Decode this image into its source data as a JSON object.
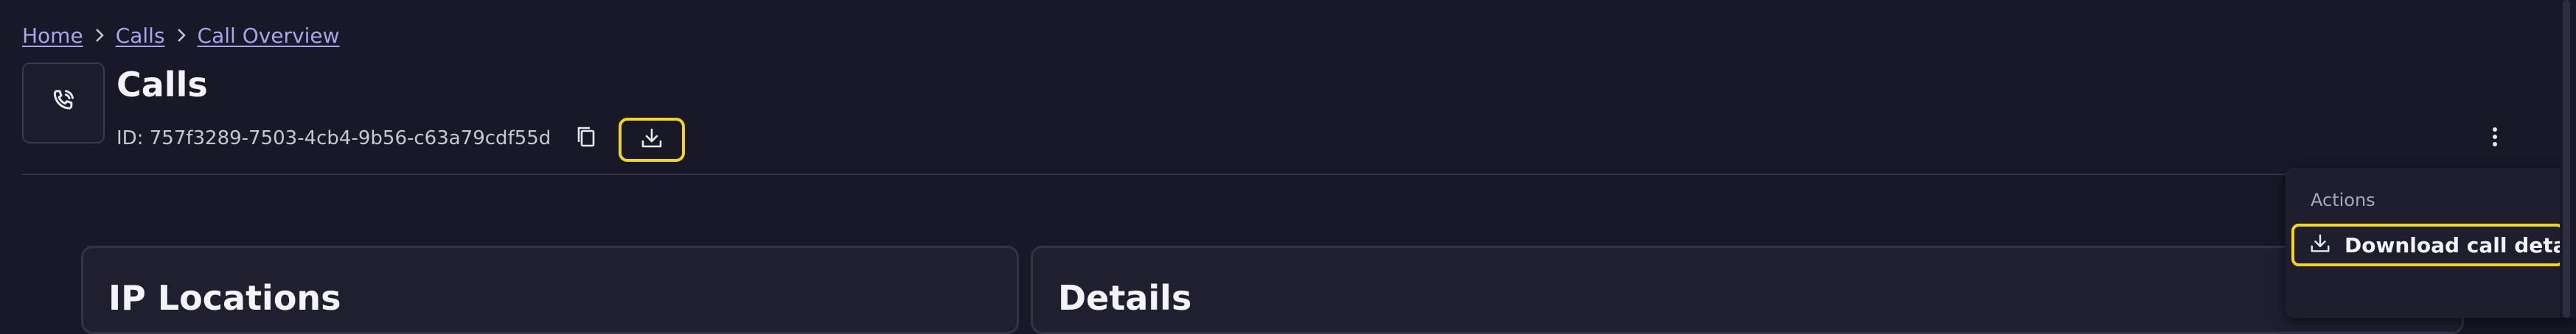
{
  "breadcrumb": {
    "items": [
      {
        "label": "Home"
      },
      {
        "label": "Calls"
      },
      {
        "label": "Call Overview"
      }
    ]
  },
  "header": {
    "title": "Calls",
    "id_text": "ID: 757f3289-7503-4cb4-9b56-c63a79cdf55d",
    "icon": "phone-call-icon"
  },
  "actions_menu": {
    "header": "Actions",
    "items": [
      {
        "label": "Download call details",
        "icon": "download-icon"
      }
    ]
  },
  "cards": {
    "ip_locations_title": "IP Locations",
    "details_title": "Details"
  },
  "colors": {
    "background": "#181827",
    "accent_link": "#a8a4f0",
    "highlight": "#f2d422",
    "card_bg": "#1f1f30"
  }
}
